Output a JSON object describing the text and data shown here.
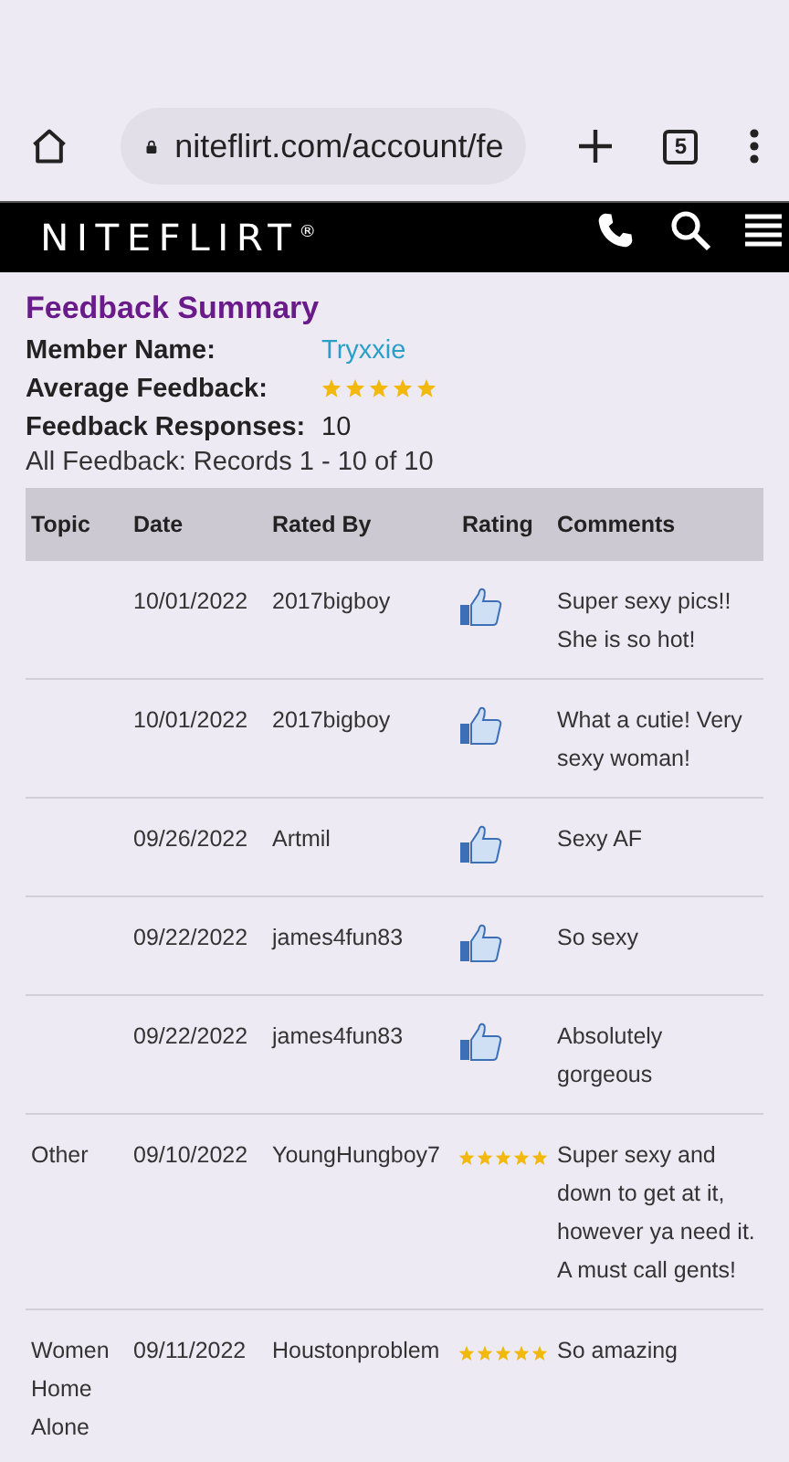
{
  "browser": {
    "url": "niteflirt.com/account/fe",
    "tab_count": "5"
  },
  "header": {
    "logo": "NITEFLIRT",
    "logo_mark": "®"
  },
  "summary": {
    "title": "Feedback Summary",
    "fields": [
      {
        "label": "Member Name:",
        "value": "Tryxxie",
        "kind": "link"
      },
      {
        "label": "Average Feedback:",
        "kind": "stars",
        "stars": 5
      },
      {
        "label": "Feedback Responses:",
        "value": "10",
        "kind": "text"
      }
    ],
    "records": "All Feedback: Records 1 - 10 of 10"
  },
  "table": {
    "columns": [
      "Topic",
      "Date",
      "Rated By",
      "Rating",
      "Comments"
    ],
    "rows": [
      {
        "topic": "",
        "date": "10/01/2022",
        "rated_by": "2017bigboy",
        "rating": {
          "kind": "thumb"
        },
        "comment": "Super sexy pics!! She is so hot!"
      },
      {
        "topic": "",
        "date": "10/01/2022",
        "rated_by": "2017bigboy",
        "rating": {
          "kind": "thumb"
        },
        "comment": "What a cutie! Very sexy woman!"
      },
      {
        "topic": "",
        "date": "09/26/2022",
        "rated_by": "Artmil",
        "rating": {
          "kind": "thumb"
        },
        "comment": "Sexy AF"
      },
      {
        "topic": "",
        "date": "09/22/2022",
        "rated_by": "james4fun83",
        "rating": {
          "kind": "thumb"
        },
        "comment": "So sexy"
      },
      {
        "topic": "",
        "date": "09/22/2022",
        "rated_by": "james4fun83",
        "rating": {
          "kind": "thumb"
        },
        "comment": "Absolutely gorgeous"
      },
      {
        "topic": "Other",
        "date": "09/10/2022",
        "rated_by": "YoungHungboy7",
        "rating": {
          "kind": "stars",
          "stars": 5
        },
        "comment": "Super sexy and down to get at it, however ya need it. A must call gents!"
      },
      {
        "topic": "Women Home Alone",
        "date": "09/11/2022",
        "rated_by": "Houstonproblem",
        "rating": {
          "kind": "stars",
          "stars": 5
        },
        "comment": "So amazing"
      }
    ]
  }
}
